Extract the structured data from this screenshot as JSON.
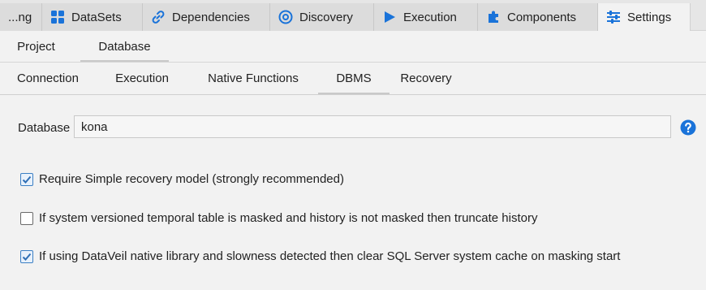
{
  "top_tabs": [
    {
      "label": "...ng",
      "icon": "none"
    },
    {
      "label": "DataSets",
      "icon": "grid-icon"
    },
    {
      "label": "Dependencies",
      "icon": "link-icon"
    },
    {
      "label": "Discovery",
      "icon": "target-icon"
    },
    {
      "label": "Execution",
      "icon": "play-icon"
    },
    {
      "label": "Components",
      "icon": "puzzle-icon"
    },
    {
      "label": "Settings",
      "icon": "sliders-icon"
    }
  ],
  "active_top_tab": "Settings",
  "settings_tabs": [
    {
      "label": "Project"
    },
    {
      "label": "Database"
    }
  ],
  "active_settings_tab": "Database",
  "database_tabs": [
    {
      "label": "Connection"
    },
    {
      "label": "Execution"
    },
    {
      "label": "Native Functions"
    },
    {
      "label": "DBMS"
    },
    {
      "label": "Recovery"
    }
  ],
  "active_database_tab": "DBMS",
  "database_field": {
    "label": "Database",
    "value": "kona"
  },
  "options": [
    {
      "label": "Require Simple recovery model (strongly recommended)",
      "checked": true
    },
    {
      "label": "If system versioned temporal table is masked and history is not masked then truncate history",
      "checked": false
    },
    {
      "label": "If using DataVeil native library and slowness detected then clear SQL Server system cache on masking start",
      "checked": true
    }
  ],
  "colors": {
    "accent": "#1a73d9",
    "checkbox_border": "#3b7fc4"
  }
}
